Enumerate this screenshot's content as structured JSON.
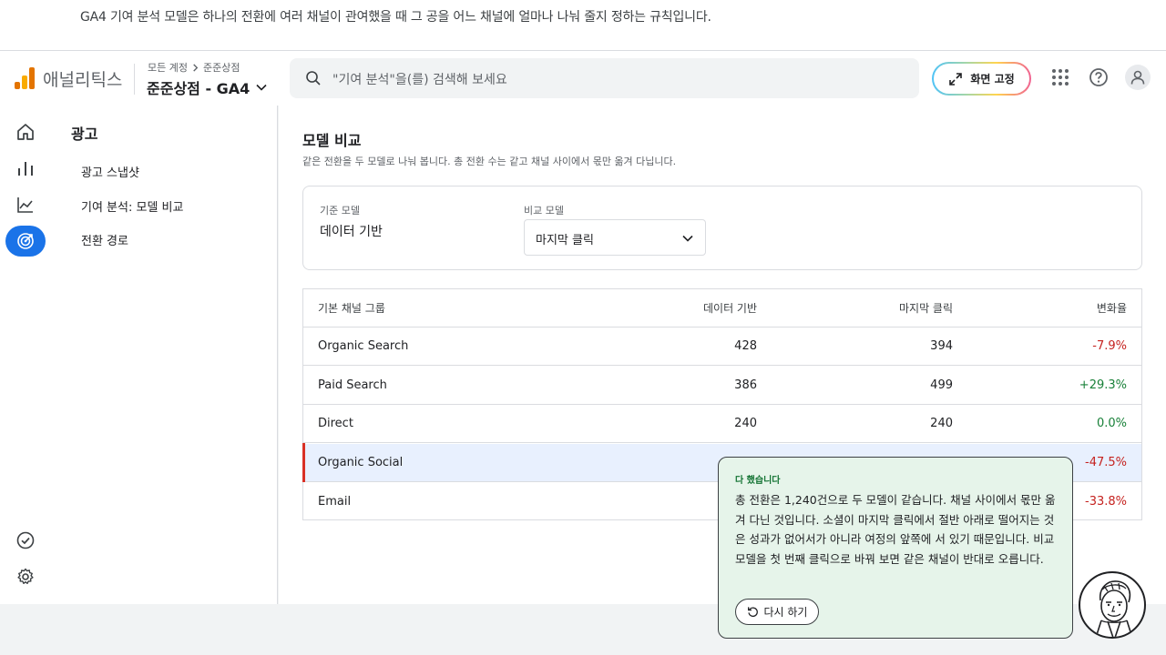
{
  "banner": {
    "text": "GA4 기여 분석 모델은 하나의 전환에 여러 채널이 관여했을 때 그 공을 어느 채널에 얼마나 나눠 줄지 정하는 규칙입니다."
  },
  "header": {
    "app_name": "애널리틱스",
    "breadcrumb": [
      "모든 계정",
      "준준상점"
    ],
    "property": "준준상점 - GA4",
    "search_placeholder": "\"기여 분석\"을(를) 검색해 보세요",
    "fix_screen_label": "화면 고정"
  },
  "icons": {
    "logo": "analytics-logo",
    "home": "home-icon",
    "reports": "bar-chart-icon",
    "explore": "line-chart-icon",
    "advertising": "target-icon",
    "configure": "check-circle-icon",
    "admin": "gear-icon",
    "apps": "apps-grid-icon",
    "help": "help-icon",
    "account": "account-icon"
  },
  "subnav": {
    "title": "광고",
    "items": [
      "광고 스냅샷",
      "기여 분석: 모델 비교",
      "전환 경로"
    ]
  },
  "main": {
    "title": "모델 비교",
    "subtitle": "같은 전환을 두 모델로 나눠 봅니다. 총 전환 수는 같고 채널 사이에서 몫만 옮겨 다닙니다.",
    "base_model_label": "기준 모델",
    "base_model_value": "데이터 기반",
    "compare_model_label": "비교 모델",
    "compare_model_value": "마지막 클릭"
  },
  "table": {
    "headers": [
      "기본 채널 그룹",
      "데이터 기반",
      "마지막 클릭",
      "변화율"
    ],
    "rows": [
      {
        "channel": "Organic Search",
        "data_driven": "428",
        "last_click": "394",
        "change": "-7.9%"
      },
      {
        "channel": "Paid Search",
        "data_driven": "386",
        "last_click": "499",
        "change": "+29.3%"
      },
      {
        "channel": "Direct",
        "data_driven": "240",
        "last_click": "240",
        "change": "0.0%"
      },
      {
        "channel": "Organic Social",
        "data_driven": "",
        "last_click": "",
        "change": "-47.5%"
      },
      {
        "channel": "Email",
        "data_driven": "",
        "last_click": "",
        "change": "-33.8%"
      }
    ]
  },
  "tooltip": {
    "title": "다 했습니다",
    "body": "총 전환은 1,240건으로 두 모델이 같습니다. 채널 사이에서 몫만 옮겨 다닌 것입니다. 소셜이 마지막 클릭에서 절반 아래로 떨어지는 것은 성과가 없어서가 아니라 여정의 앞쪽에 서 있기 때문입니다. 비교 모델을 첫 번째 클릭으로 바꿔 보면 같은 채널이 반대로 오릅니다.",
    "retry_label": "다시 하기"
  },
  "colors": {
    "accent": "#1a73e8",
    "negative": "#c5221f",
    "positive": "#188038",
    "selected_row": "#e8f0fe",
    "tooltip_bg": "#e6f4ea"
  }
}
